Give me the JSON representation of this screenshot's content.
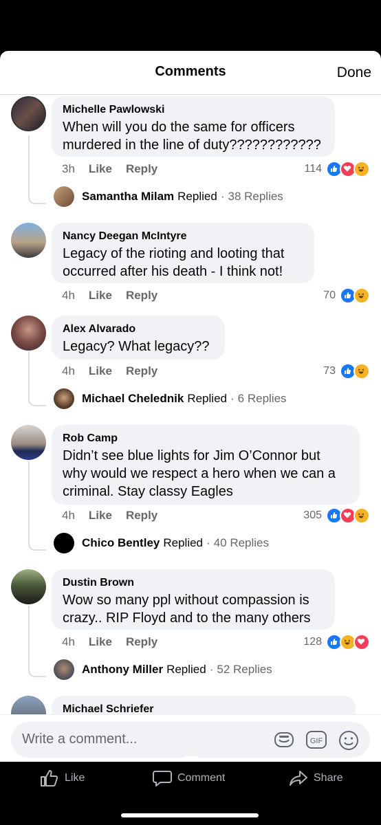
{
  "header": {
    "title": "Comments",
    "done": "Done"
  },
  "actions": {
    "like": "Like",
    "reply": "Reply"
  },
  "comments": [
    {
      "name": "Michelle Pawlowski",
      "text_lines": [
        "When will you do the same for officers",
        "murdered in the line of duty????????????"
      ],
      "time": "3h",
      "reactions": "114",
      "reply": {
        "name": "Samantha Milam",
        "replied": "Replied",
        "count": "38 Replies"
      }
    },
    {
      "name": "Nancy Deegan McIntyre",
      "text_lines": [
        "Legacy of the rioting  and looting that",
        "occurred after his death - I think not!"
      ],
      "time": "4h",
      "reactions": "70"
    },
    {
      "name": "Alex Alvarado",
      "text_lines": [
        "Legacy? What legacy??"
      ],
      "time": "4h",
      "reactions": "73",
      "reply": {
        "name": "Michael Chelednik",
        "replied": "Replied",
        "count": "6 Replies"
      }
    },
    {
      "name": "Rob Camp",
      "text_lines": [
        "Didn’t see blue lights for Jim O’Connor but",
        "why would we respect a hero when we can a",
        "criminal. Stay classy Eagles"
      ],
      "time": "4h",
      "reactions": "305",
      "reply": {
        "name": "Chico Bentley",
        "replied": "Replied",
        "count": "40 Replies"
      }
    },
    {
      "name": "Dustin Brown",
      "text_lines": [
        "Wow so many ppl without compassion is",
        "crazy.. RIP Floyd  and to the many others"
      ],
      "time": "4h",
      "reactions": "128",
      "reply": {
        "name": "Anthony Miller",
        "replied": "Replied",
        "count": "52 Replies"
      }
    },
    {
      "name": "Michael Schriefer"
    }
  ],
  "composer": {
    "placeholder": "Write a comment...",
    "gif_label": "GIF"
  },
  "bottom_tabs": {
    "like": "Like",
    "comment": "Comment",
    "share": "Share"
  },
  "colors": {
    "like_blue": "#1877f2",
    "love_red": "#f33e58",
    "haha_yellow": "#f7b125"
  }
}
